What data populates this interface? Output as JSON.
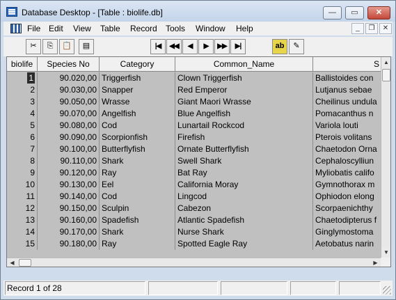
{
  "window": {
    "title": "Database Desktop - [Table : biolife.db]",
    "min_glyph": "—",
    "max_glyph": "▭",
    "close_glyph": "✕"
  },
  "menubar": {
    "items": [
      "File",
      "Edit",
      "View",
      "Table",
      "Record",
      "Tools",
      "Window",
      "Help"
    ],
    "mdi_min": "_",
    "mdi_restore": "❐",
    "mdi_close": "✕"
  },
  "toolbar": {
    "cut_icon": "✂",
    "copy_icon": "⎘",
    "paste_icon": "📋",
    "print_icon": "▤",
    "first_icon": "|◀",
    "prev_set_icon": "◀◀",
    "prev_icon": "◀",
    "next_icon": "▶",
    "next_set_icon": "▶▶",
    "last_icon": "▶|",
    "field_view_icon": "ab",
    "edit_data_icon": "✎"
  },
  "grid": {
    "columns": [
      "biolife",
      "Species No",
      "Category",
      "Common_Name",
      "S"
    ],
    "rows": [
      [
        "1",
        "90.020,00",
        "Triggerfish",
        "Clown Triggerfish",
        "Ballistoides con"
      ],
      [
        "2",
        "90.030,00",
        "Snapper",
        "Red Emperor",
        "Lutjanus sebae"
      ],
      [
        "3",
        "90.050,00",
        "Wrasse",
        "Giant Maori Wrasse",
        "Cheilinus undula"
      ],
      [
        "4",
        "90.070,00",
        "Angelfish",
        "Blue Angelfish",
        "Pomacanthus n"
      ],
      [
        "5",
        "90.080,00",
        "Cod",
        "Lunartail Rockcod",
        "Variola louti"
      ],
      [
        "6",
        "90.090,00",
        "Scorpionfish",
        "Firefish",
        "Pterois volitans"
      ],
      [
        "7",
        "90.100,00",
        "Butterflyfish",
        "Ornate Butterflyfish",
        "Chaetodon Orna"
      ],
      [
        "8",
        "90.110,00",
        "Shark",
        "Swell Shark",
        "Cephaloscylliun"
      ],
      [
        "9",
        "90.120,00",
        "Ray",
        "Bat Ray",
        "Myliobatis califo"
      ],
      [
        "10",
        "90.130,00",
        "Eel",
        "California Moray",
        "Gymnothorax m"
      ],
      [
        "11",
        "90.140,00",
        "Cod",
        "Lingcod",
        "Ophiodon elong"
      ],
      [
        "12",
        "90.150,00",
        "Sculpin",
        "Cabezon",
        "Scorpaenichthy"
      ],
      [
        "13",
        "90.160,00",
        "Spadefish",
        "Atlantic Spadefish",
        "Chaetodipterus f"
      ],
      [
        "14",
        "90.170,00",
        "Shark",
        "Nurse Shark",
        "Ginglymostoma"
      ],
      [
        "15",
        "90.180,00",
        "Ray",
        "Spotted Eagle Ray",
        "Aetobatus narin"
      ]
    ],
    "scroll_up": "▲",
    "scroll_down": "▼",
    "scroll_left": "◀",
    "scroll_right": "▶"
  },
  "status": {
    "record_text": "Record 1 of 28",
    "pane2": "",
    "pane3": "",
    "pane4": "",
    "pane5": ""
  }
}
